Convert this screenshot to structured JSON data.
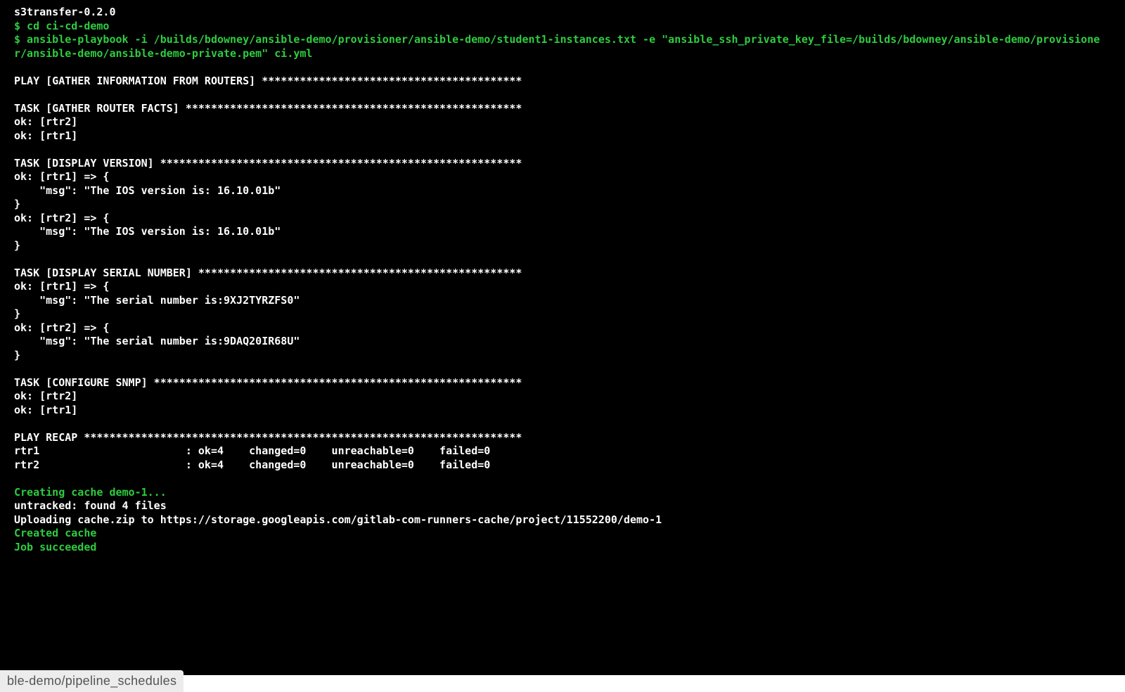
{
  "terminal": {
    "lines": [
      {
        "text": "s3transfer-0.2.0",
        "class": "white"
      },
      {
        "text": "$ cd ci-cd-demo",
        "class": "green"
      },
      {
        "text": "$ ansible-playbook -i /builds/bdowney/ansible-demo/provisioner/ansible-demo/student1-instances.txt -e \"ansible_ssh_private_key_file=/builds/bdowney/ansible-demo/provisioner/ansible-demo/ansible-demo-private.pem\" ci.yml",
        "class": "green"
      },
      {
        "text": "",
        "class": "blank"
      },
      {
        "text": "PLAY [GATHER INFORMATION FROM ROUTERS] *****************************************",
        "class": "white"
      },
      {
        "text": "",
        "class": "blank"
      },
      {
        "text": "TASK [GATHER ROUTER FACTS] *****************************************************",
        "class": "white"
      },
      {
        "text": "ok: [rtr2]",
        "class": "white"
      },
      {
        "text": "ok: [rtr1]",
        "class": "white"
      },
      {
        "text": "",
        "class": "blank"
      },
      {
        "text": "TASK [DISPLAY VERSION] *********************************************************",
        "class": "white"
      },
      {
        "text": "ok: [rtr1] => {",
        "class": "white"
      },
      {
        "text": "    \"msg\": \"The IOS version is: 16.10.01b\"",
        "class": "white"
      },
      {
        "text": "}",
        "class": "white"
      },
      {
        "text": "ok: [rtr2] => {",
        "class": "white"
      },
      {
        "text": "    \"msg\": \"The IOS version is: 16.10.01b\"",
        "class": "white"
      },
      {
        "text": "}",
        "class": "white"
      },
      {
        "text": "",
        "class": "blank"
      },
      {
        "text": "TASK [DISPLAY SERIAL NUMBER] ***************************************************",
        "class": "white"
      },
      {
        "text": "ok: [rtr1] => {",
        "class": "white"
      },
      {
        "text": "    \"msg\": \"The serial number is:9XJ2TYRZFS0\"",
        "class": "white"
      },
      {
        "text": "}",
        "class": "white"
      },
      {
        "text": "ok: [rtr2] => {",
        "class": "white"
      },
      {
        "text": "    \"msg\": \"The serial number is:9DAQ20IR68U\"",
        "class": "white"
      },
      {
        "text": "}",
        "class": "white"
      },
      {
        "text": "",
        "class": "blank"
      },
      {
        "text": "TASK [CONFIGURE SNMP] **********************************************************",
        "class": "white"
      },
      {
        "text": "ok: [rtr2]",
        "class": "white"
      },
      {
        "text": "ok: [rtr1]",
        "class": "white"
      },
      {
        "text": "",
        "class": "blank"
      },
      {
        "text": "PLAY RECAP *********************************************************************",
        "class": "white"
      },
      {
        "text": "rtr1                       : ok=4    changed=0    unreachable=0    failed=0",
        "class": "white"
      },
      {
        "text": "rtr2                       : ok=4    changed=0    unreachable=0    failed=0",
        "class": "white"
      },
      {
        "text": "",
        "class": "blank"
      },
      {
        "text": "Creating cache demo-1...",
        "class": "green"
      },
      {
        "text": "untracked: found 4 files",
        "class": "white"
      },
      {
        "text": "Uploading cache.zip to https://storage.googleapis.com/gitlab-com-runners-cache/project/11552200/demo-1",
        "class": "white"
      },
      {
        "text": "Created cache",
        "class": "green"
      },
      {
        "text": "Job succeeded",
        "class": "green"
      }
    ]
  },
  "status_bar": {
    "url_fragment": "ble-demo/pipeline_schedules"
  }
}
